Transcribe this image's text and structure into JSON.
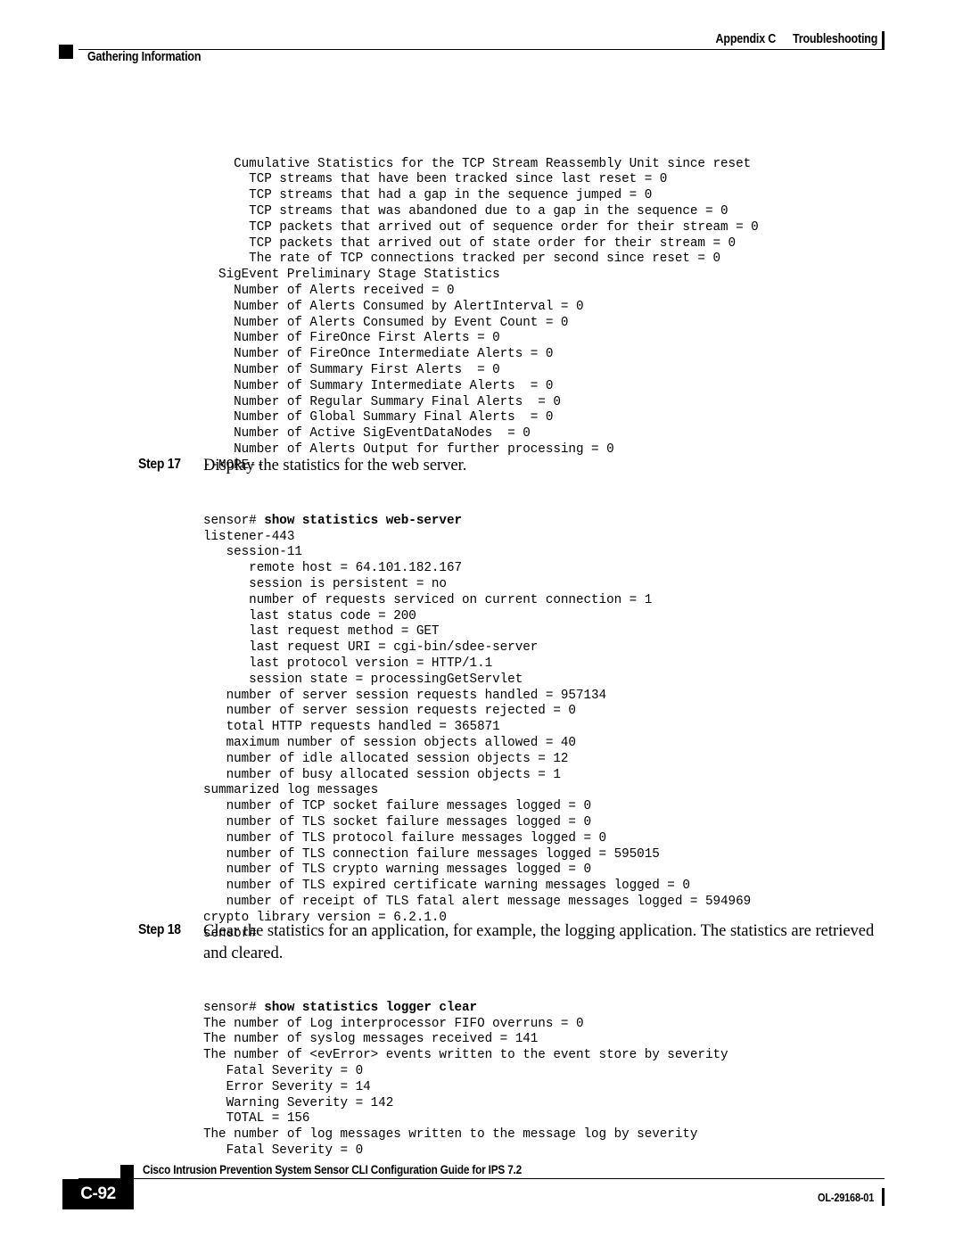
{
  "header": {
    "appendix": "Appendix C",
    "chapter": "Troubleshooting",
    "section": "Gathering Information"
  },
  "footer": {
    "page_number": "C-92",
    "guide_title": "Cisco Intrusion Prevention System Sensor CLI Configuration Guide for IPS 7.2",
    "doc_number": "OL-29168-01"
  },
  "code_block_top": "    Cumulative Statistics for the TCP Stream Reassembly Unit since reset\n      TCP streams that have been tracked since last reset = 0\n      TCP streams that had a gap in the sequence jumped = 0\n      TCP streams that was abandoned due to a gap in the sequence = 0\n      TCP packets that arrived out of sequence order for their stream = 0\n      TCP packets that arrived out of state order for their stream = 0\n      The rate of TCP connections tracked per second since reset = 0\n  SigEvent Preliminary Stage Statistics\n    Number of Alerts received = 0\n    Number of Alerts Consumed by AlertInterval = 0\n    Number of Alerts Consumed by Event Count = 0\n    Number of FireOnce First Alerts = 0\n    Number of FireOnce Intermediate Alerts = 0\n    Number of Summary First Alerts  = 0\n    Number of Summary Intermediate Alerts  = 0\n    Number of Regular Summary Final Alerts  = 0\n    Number of Global Summary Final Alerts  = 0\n    Number of Active SigEventDataNodes  = 0\n    Number of Alerts Output for further processing = 0\n--MORE--",
  "steps": [
    {
      "label": "Step 17",
      "text": "Display the statistics for the web server.",
      "prompt": "sensor# ",
      "command": "show statistics web-server",
      "output": "listener-443\n   session-11\n      remote host = 64.101.182.167\n      session is persistent = no\n      number of requests serviced on current connection = 1\n      last status code = 200\n      last request method = GET\n      last request URI = cgi-bin/sdee-server\n      last protocol version = HTTP/1.1\n      session state = processingGetServlet\n   number of server session requests handled = 957134\n   number of server session requests rejected = 0\n   total HTTP requests handled = 365871\n   maximum number of session objects allowed = 40\n   number of idle allocated session objects = 12\n   number of busy allocated session objects = 1\nsummarized log messages\n   number of TCP socket failure messages logged = 0\n   number of TLS socket failure messages logged = 0\n   number of TLS protocol failure messages logged = 0\n   number of TLS connection failure messages logged = 595015\n   number of TLS crypto warning messages logged = 0\n   number of TLS expired certificate warning messages logged = 0\n   number of receipt of TLS fatal alert message messages logged = 594969\ncrypto library version = 6.2.1.0\nsensor#"
    },
    {
      "label": "Step 18",
      "text": "Clear the statistics for an application, for example, the logging application. The statistics are retrieved and cleared.",
      "prompt": "sensor# ",
      "command": "show statistics logger clear",
      "output": "The number of Log interprocessor FIFO overruns = 0\nThe number of syslog messages received = 141\nThe number of <evError> events written to the event store by severity\n   Fatal Severity = 0\n   Error Severity = 14\n   Warning Severity = 142\n   TOTAL = 156\nThe number of log messages written to the message log by severity\n   Fatal Severity = 0"
    }
  ]
}
